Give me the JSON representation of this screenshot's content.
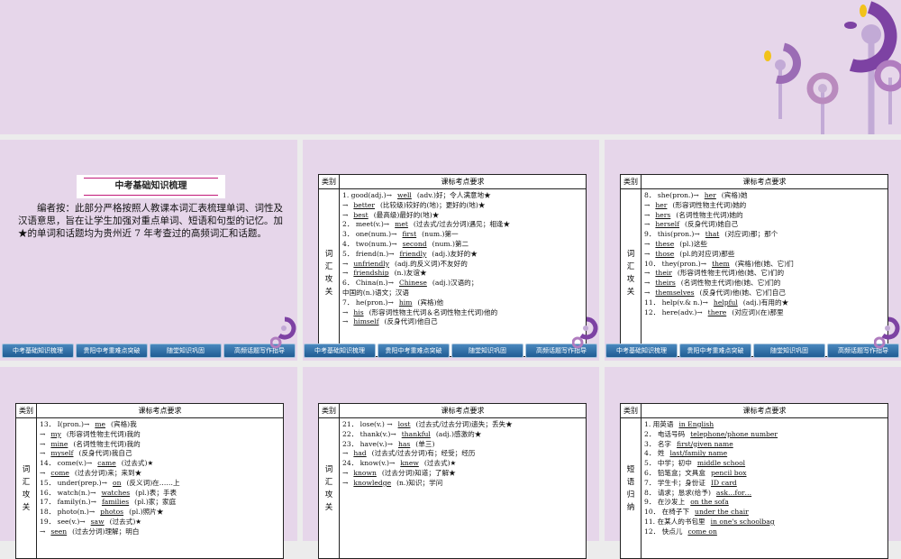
{
  "nav": [
    "中考基础知识梳理",
    "贵阳中考重难点突破",
    "随堂知识巩固",
    "高频话题写作指导"
  ],
  "slide1": {
    "title": "中考基础知识梳理",
    "intro": "编者按：此部分严格按照人教课本词汇表梳理单词、词性及汉语意思，旨在让学生加强对重点单词、短语和句型的记忆。加★的单词和话题均为贵州近 7 年考查过的高频词汇和话题。"
  },
  "table_header": {
    "category": "类别",
    "requirement": "课标考点要求"
  },
  "tables": [
    {
      "category": [
        "词",
        "汇",
        "攻",
        "关"
      ],
      "lines": [
        {
          "pre": "1. good(adj.)→",
          "ans": "well",
          "post": "(adv.)好；令人满意地★"
        },
        {
          "pre": "→",
          "ans": "better",
          "post": "(比较级)较好的(地)；更好的(地)★"
        },
        {
          "pre": "→",
          "ans": "best",
          "post": "(最高级)最好的(地)★"
        },
        {
          "pre": "2． meet(v.)→",
          "ans": "met",
          "post": "(过去式/过去分词)遇见；相逢★"
        },
        {
          "pre": "3． one(num.)→",
          "ans": "first",
          "post": "(num.)第一"
        },
        {
          "pre": "4． two(num.)→",
          "ans": "second",
          "post": "(num.)第二"
        },
        {
          "pre": "5． friend(n.)→",
          "ans": "friendly",
          "post": "(adj.)友好的★"
        },
        {
          "pre": " →",
          "ans": "unfriendly",
          "post": "(adj.的反义词)不友好的"
        },
        {
          "pre": " →",
          "ans": "friendship",
          "post": "(n.)友谊★"
        },
        {
          "pre": "6． China(n.)→",
          "ans": "Chinese",
          "post": "(adj.)汉语的；"
        },
        {
          "pre": "中国的(n.)语文；汉语",
          "ans": "",
          "post": ""
        },
        {
          "pre": "7． he(pron.)→",
          "ans": "him",
          "post": "(宾格)他"
        },
        {
          "pre": "→",
          "ans": "his",
          "post": "(形容词性物主代词＆名词性物主代词)他的"
        },
        {
          "pre": "→",
          "ans": "himself",
          "post": "(反身代词)他自己"
        }
      ]
    },
    {
      "category": [
        "词",
        "汇",
        "攻",
        "关"
      ],
      "lines": [
        {
          "pre": "8． she(pron.)→",
          "ans": "her",
          "post": "(宾格)她"
        },
        {
          "pre": "→",
          "ans": "her",
          "post": "(形容词性物主代词)她的"
        },
        {
          "pre": "→",
          "ans": "hers",
          "post": "(名词性物主代词)她的"
        },
        {
          "pre": "→",
          "ans": "herself",
          "post": "(反身代词)她自己"
        },
        {
          "pre": "9． this(pron.)→",
          "ans": "that",
          "post": "(对应词)那；那个"
        },
        {
          "pre": "→",
          "ans": "these",
          "post": "(pl.)这些"
        },
        {
          "pre": "      →",
          "ans": "those",
          "post": "(pl.的对应词)那些"
        },
        {
          "pre": "10． they(pron.)→",
          "ans": "them",
          "post": "(宾格)他(她、它)们"
        },
        {
          "pre": " →",
          "ans": "their",
          "post": "(形容词性物主代词)他(她、它)们的"
        },
        {
          "pre": "→",
          "ans": "theirs",
          "post": "(名词性物主代词)他(她、它)们的"
        },
        {
          "pre": "  →",
          "ans": "themselves",
          "post": "(反身代词)他(她、它)们自己"
        },
        {
          "pre": "11． help(v.& n.)→",
          "ans": "helpful",
          "post": "(adj.)有用的★"
        },
        {
          "pre": "12． here(adv.)→",
          "ans": "there",
          "post": "(对应词)(在)那里"
        }
      ]
    },
    {
      "category": [
        "词",
        "汇",
        "攻",
        "关"
      ],
      "lines": [
        {
          "pre": "13． I(pron.)→",
          "ans": "me",
          "post": "(宾格)我"
        },
        {
          "pre": "→",
          "ans": "my",
          "post": "(形容词性物主代词)我的"
        },
        {
          "pre": "→",
          "ans": "mine",
          "post": "(名词性物主代词)我的"
        },
        {
          "pre": "→",
          "ans": "myself",
          "post": "(反身代词)我自己"
        },
        {
          "pre": "14． come(v.)→",
          "ans": "came",
          "post": "(过去式)★"
        },
        {
          "pre": "      →",
          "ans": "come",
          "post": "(过去分词)来；来到★"
        },
        {
          "pre": "15． under(prep.)→",
          "ans": "on",
          "post": "(反义词)在……上"
        },
        {
          "pre": "16． watch(n.)→",
          "ans": "watches",
          "post": "(pl.)表；手表"
        },
        {
          "pre": "17． family(n.)→",
          "ans": "families",
          "post": "(pl.)家；家庭"
        },
        {
          "pre": "18． photo(n.)→",
          "ans": "photos",
          "post": "(pl.)照片★"
        },
        {
          "pre": "19． see(v.)→",
          "ans": "saw",
          "post": "(过去式)★"
        },
        {
          "pre": " →",
          "ans": "seen",
          "post": "(过去分词)理解；明白"
        }
      ]
    },
    {
      "category": [
        "词",
        "汇",
        "攻",
        "关"
      ],
      "lines": [
        {
          "pre": "21． lose(v.) →",
          "ans": "lost",
          "post": "(过去式/过去分词)遗失；丢失★"
        },
        {
          "pre": "22． thank(v.)→",
          "ans": "thankful",
          "post": "(adj.)感激的★"
        },
        {
          "pre": "23． have(v.)→",
          "ans": "has",
          "post": "(单三)"
        },
        {
          "pre": "            →",
          "ans": "had",
          "post": "(过去式/过去分词)有；经受；经历"
        },
        {
          "pre": "24． know(v.)→",
          "ans": "knew",
          "post": "(过去式)★"
        },
        {
          "pre": "            →",
          "ans": "known",
          "post": "(过去分词)知道；了解★"
        },
        {
          "pre": "            →",
          "ans": "knowledge",
          "post": "(n.)知识；学问"
        }
      ]
    },
    {
      "category": [
        "短",
        "语",
        "归",
        "纳"
      ],
      "lines": [
        {
          "pre": "1. 用英语",
          "ans": "in English",
          "post": ""
        },
        {
          "pre": "2． 电话号码",
          "ans": "telephone/phone number",
          "post": ""
        },
        {
          "pre": "3． 名字",
          "ans": "first/given name",
          "post": ""
        },
        {
          "pre": "4． 姓",
          "ans": "last/family name",
          "post": ""
        },
        {
          "pre": "5． 中学；初中",
          "ans": "middle school",
          "post": ""
        },
        {
          "pre": "6． 铅笔盒；文具盒",
          "ans": "pencil box",
          "post": ""
        },
        {
          "pre": "7． 学生卡；身份证",
          "ans": "ID card",
          "post": ""
        },
        {
          "pre": "8． 请求；恳求(给予)",
          "ans": "ask…for…",
          "post": ""
        },
        {
          "pre": "9． 在沙发上",
          "ans": "on the sofa",
          "post": ""
        },
        {
          "pre": "10． 在椅子下",
          "ans": "under the chair",
          "post": ""
        },
        {
          "pre": "11. 在某人的书包里",
          "ans": "in one's schoolbag",
          "post": ""
        },
        {
          "pre": "12． 快点儿",
          "ans": "come on",
          "post": ""
        }
      ]
    }
  ]
}
